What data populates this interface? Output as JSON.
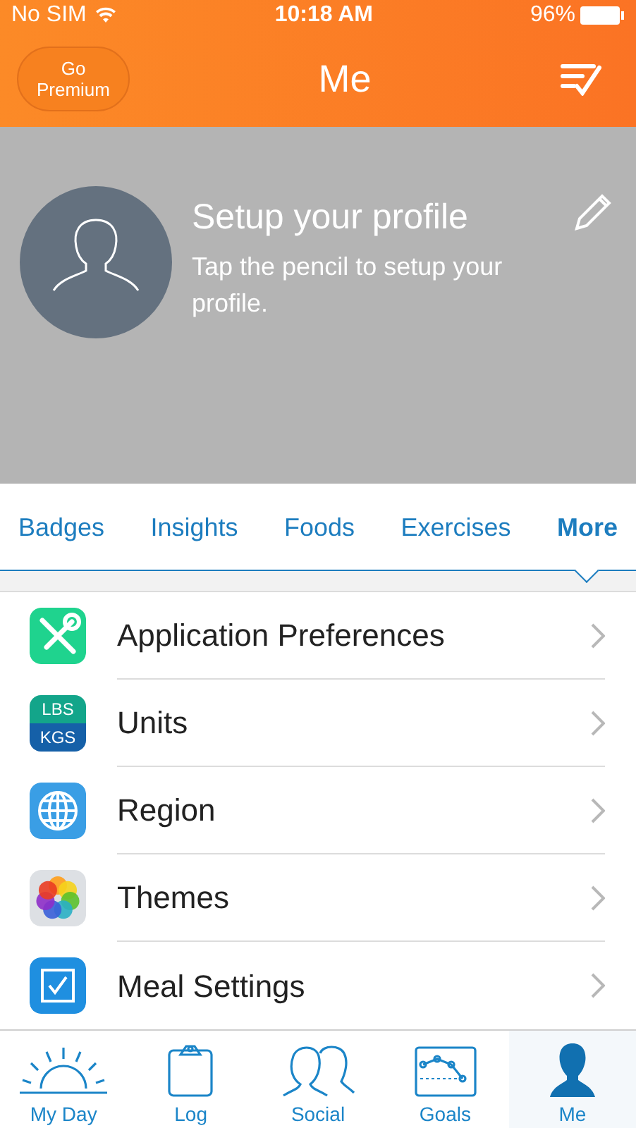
{
  "status_bar": {
    "carrier": "No SIM",
    "time": "10:18 AM",
    "battery": "96%"
  },
  "nav": {
    "premium_button": "Go Premium",
    "title": "Me"
  },
  "profile": {
    "title": "Setup your profile",
    "subtitle": "Tap the pencil to setup your profile."
  },
  "tabs": [
    {
      "label": "Badges",
      "selected": false
    },
    {
      "label": "Insights",
      "selected": false
    },
    {
      "label": "Foods",
      "selected": false
    },
    {
      "label": "Exercises",
      "selected": false
    },
    {
      "label": "More",
      "selected": true
    }
  ],
  "menu": [
    {
      "kind": "tools",
      "label": "Application Preferences"
    },
    {
      "kind": "units",
      "label": "Units",
      "icon_top": "LBS",
      "icon_bottom": "KGS"
    },
    {
      "kind": "globe",
      "label": "Region"
    },
    {
      "kind": "palette",
      "label": "Themes"
    },
    {
      "kind": "check",
      "label": "Meal Settings"
    }
  ],
  "tab_bar": [
    {
      "kind": "sun",
      "label": "My Day",
      "selected": false
    },
    {
      "kind": "clipboard",
      "label": "Log",
      "selected": false
    },
    {
      "kind": "people",
      "label": "Social",
      "selected": false
    },
    {
      "kind": "chart",
      "label": "Goals",
      "selected": false
    },
    {
      "kind": "person",
      "label": "Me",
      "selected": true
    }
  ]
}
